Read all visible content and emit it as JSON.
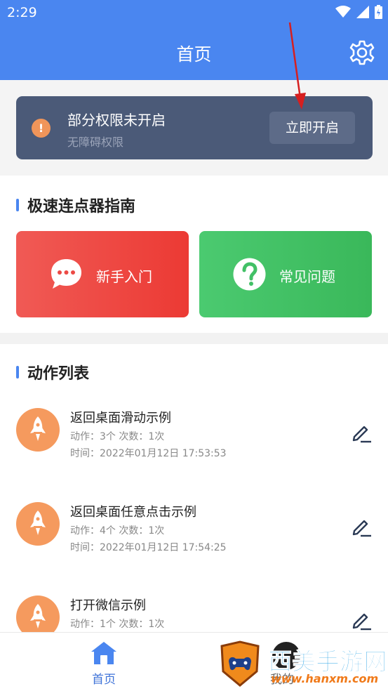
{
  "status_bar": {
    "time": "2:29"
  },
  "app_bar": {
    "title": "首页"
  },
  "permission": {
    "title": "部分权限未开启",
    "subtitle": "无障碍权限",
    "button": "立即开启"
  },
  "guide": {
    "title": "极速连点器指南",
    "cards": [
      {
        "label": "新手入门"
      },
      {
        "label": "常见问题"
      }
    ]
  },
  "actions": {
    "title": "动作列表",
    "items": [
      {
        "name": "返回桌面滑动示例",
        "meta": "动作：3个 次数：1次",
        "time": "时间：2022年01月12日 17:53:53"
      },
      {
        "name": "返回桌面任意点击示例",
        "meta": "动作：4个 次数：1次",
        "time": "时间：2022年01月12日 17:54:25"
      },
      {
        "name": "打开微信示例",
        "meta": "动作：1个 次数：1次",
        "time": ""
      }
    ]
  },
  "tabbar": {
    "home": "首页",
    "mine": "我的"
  },
  "watermark": {
    "text": "西美手游网",
    "url": "www.hanxm.com"
  },
  "colors": {
    "primary": "#4a86f0",
    "card_dark": "#4b5a78",
    "red": "#ec3a34",
    "green": "#3ab85a",
    "orange": "#f59a5e"
  }
}
